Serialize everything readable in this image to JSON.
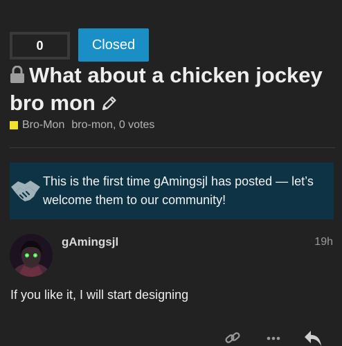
{
  "topic": {
    "vote_count": "0",
    "status_label": "Closed",
    "title": "What about a chicken jockey bro mon",
    "category": "Bro-Mon",
    "category_color": "#f0e12e",
    "tags_votes": "bro-mon, 0 votes"
  },
  "notice": {
    "text": "This is the first time gAmingsjl has posted — let’s welcome them to our community!",
    "icon": "handshake-icon"
  },
  "post": {
    "username": "gAmingsjl",
    "time": "19h",
    "body": "If you like it, I will start designing"
  },
  "actions": [
    "link-icon",
    "more-icon",
    "reply-icon"
  ],
  "colors": {
    "background": "#222222",
    "accent": "#1a8fc6",
    "notice_bg": "#0d3344"
  }
}
